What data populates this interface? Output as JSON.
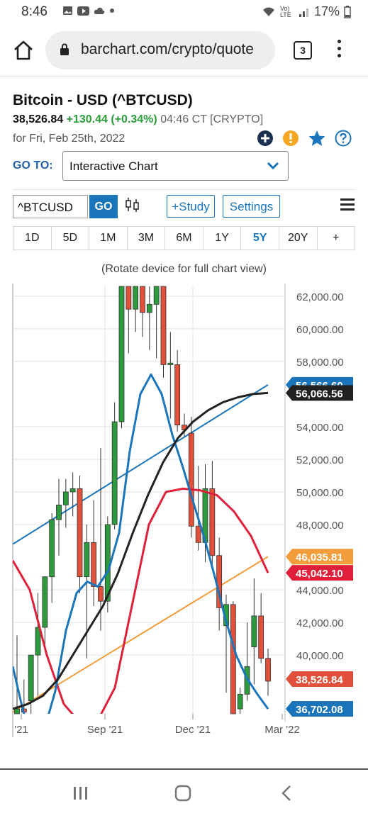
{
  "status": {
    "time": "8:46",
    "battery": "17%",
    "network": "Vo) LTE"
  },
  "browser": {
    "url": "barchart.com/crypto/quote",
    "tab_count": "3"
  },
  "quote": {
    "title": "Bitcoin - USD (^BTCUSD)",
    "last": "38,526.84",
    "change": "+130.44 (+0.34%)",
    "time": "04:46 CT [CRYPTO]",
    "date": "for Fri, Feb 25th, 2022"
  },
  "goto": {
    "label": "GO TO:",
    "value": "Interactive Chart"
  },
  "toolbar": {
    "symbol": "^BTCUSD",
    "go": "GO",
    "study": "+Study",
    "settings": "Settings"
  },
  "periods": [
    "1D",
    "5D",
    "1M",
    "3M",
    "6M",
    "1Y",
    "5Y",
    "20Y",
    "+"
  ],
  "active_period": "5Y",
  "note": "(Rotate device for full chart view)",
  "colors": {
    "up": "#2e9a3e",
    "down": "#e0503a",
    "ma_blue": "#1b75bb",
    "ma_black": "#222222",
    "ma_red": "#e0203a",
    "trend_orange": "#f39c3a"
  },
  "chart_data": {
    "type": "candlestick",
    "ylim": [
      36400,
      62600
    ],
    "y_ticks": [
      "62,000.00",
      "60,000.00",
      "58,000.00",
      "54,000.00",
      "52,000.00",
      "50,000.00",
      "48,000.00",
      "44,000.00",
      "42,000.00",
      "40,000.00"
    ],
    "x_labels": [
      "'21",
      "Sep '21",
      "Dec '21",
      "Mar '22"
    ],
    "price_tags": [
      {
        "label": "56,566.60",
        "value": 56566.6,
        "color": "#1b75bb"
      },
      {
        "label": "56,066.56",
        "value": 56066.56,
        "color": "#222222"
      },
      {
        "label": "46,035.81",
        "value": 46035.81,
        "color": "#f39c3a"
      },
      {
        "label": "45,042.10",
        "value": 45042.1,
        "color": "#e0203a"
      },
      {
        "label": "38,526.84",
        "value": 38526.84,
        "color": "#e0503a"
      },
      {
        "label": "36,702.08",
        "value": 36702.08,
        "color": "#1b75bb"
      }
    ],
    "candles": [
      {
        "o": 36300,
        "h": 41200,
        "l": 35800,
        "c": 36700
      },
      {
        "o": 36700,
        "h": 38500,
        "l": 35500,
        "c": 36500
      },
      {
        "o": 37200,
        "h": 39800,
        "l": 36000,
        "c": 40000
      },
      {
        "o": 40000,
        "h": 43800,
        "l": 37500,
        "c": 41700
      },
      {
        "o": 41700,
        "h": 44500,
        "l": 40500,
        "c": 44800
      },
      {
        "o": 44800,
        "h": 48700,
        "l": 43200,
        "c": 48300
      },
      {
        "o": 48300,
        "h": 50800,
        "l": 46100,
        "c": 49200
      },
      {
        "o": 49200,
        "h": 50800,
        "l": 47800,
        "c": 50000
      },
      {
        "o": 50000,
        "h": 51200,
        "l": 48500,
        "c": 50200
      },
      {
        "o": 50200,
        "h": 51000,
        "l": 43800,
        "c": 44800
      },
      {
        "o": 44800,
        "h": 48000,
        "l": 39800,
        "c": 46900
      },
      {
        "o": 46900,
        "h": 49500,
        "l": 43000,
        "c": 44200
      },
      {
        "o": 44200,
        "h": 52700,
        "l": 41500,
        "c": 43300
      },
      {
        "o": 43300,
        "h": 48500,
        "l": 42600,
        "c": 48000
      },
      {
        "o": 48000,
        "h": 55500,
        "l": 47700,
        "c": 54300
      },
      {
        "o": 54300,
        "h": 62700,
        "l": 53900,
        "c": 62600
      },
      {
        "o": 62600,
        "h": 62600,
        "l": 58500,
        "c": 61200
      },
      {
        "o": 61200,
        "h": 62600,
        "l": 59800,
        "c": 62600
      },
      {
        "o": 62600,
        "h": 62600,
        "l": 59500,
        "c": 61000
      },
      {
        "o": 61000,
        "h": 62600,
        "l": 58700,
        "c": 61500
      },
      {
        "o": 61500,
        "h": 62600,
        "l": 58200,
        "c": 62600
      },
      {
        "o": 62600,
        "h": 62600,
        "l": 57000,
        "c": 57800
      },
      {
        "o": 57800,
        "h": 59800,
        "l": 54500,
        "c": 57900
      },
      {
        "o": 57800,
        "h": 58700,
        "l": 53700,
        "c": 54100
      },
      {
        "o": 54100,
        "h": 54800,
        "l": 53400,
        "c": 53800
      },
      {
        "o": 53600,
        "h": 54600,
        "l": 47200,
        "c": 47900
      },
      {
        "o": 47900,
        "h": 51600,
        "l": 46400,
        "c": 46900
      },
      {
        "o": 46900,
        "h": 51700,
        "l": 45700,
        "c": 50200
      },
      {
        "o": 50200,
        "h": 51900,
        "l": 45300,
        "c": 46100
      },
      {
        "o": 46100,
        "h": 47200,
        "l": 41500,
        "c": 42900
      },
      {
        "o": 41800,
        "h": 43700,
        "l": 37700,
        "c": 43100
      },
      {
        "o": 43100,
        "h": 43300,
        "l": 36600,
        "c": 36300
      },
      {
        "o": 36700,
        "h": 38000,
        "l": 36300,
        "c": 37600
      },
      {
        "o": 37600,
        "h": 42000,
        "l": 37200,
        "c": 39300
      },
      {
        "o": 40500,
        "h": 44700,
        "l": 38200,
        "c": 42400
      },
      {
        "o": 42400,
        "h": 43800,
        "l": 39500,
        "c": 39800
      },
      {
        "o": 39800,
        "h": 40400,
        "l": 37500,
        "c": 38400
      }
    ],
    "ma_blue": [
      39300,
      36500,
      35000,
      35500,
      37800,
      41500,
      43800,
      44500,
      44200,
      45200,
      47500,
      52500,
      56000,
      57200,
      56000,
      53500,
      51500,
      49300,
      47200,
      44800,
      42200,
      40000,
      38600,
      37600,
      36700
    ],
    "ma_black": [
      36700,
      37000,
      37500,
      38500,
      40000,
      41500,
      43000,
      45000,
      47500,
      49800,
      51800,
      53300,
      54300,
      55000,
      55500,
      55800,
      56000,
      56066
    ],
    "ma_red": [
      45800,
      44000,
      40000,
      37000,
      35800,
      36000,
      38000,
      43000,
      48000,
      50000,
      50200,
      50100,
      49800,
      48800,
      47300,
      45042
    ],
    "trend_blue": [
      46800,
      56566
    ],
    "trend_orange": [
      36500,
      46036
    ]
  },
  "navbar": {
    "recent": "|||",
    "home": "O",
    "back": "<"
  }
}
